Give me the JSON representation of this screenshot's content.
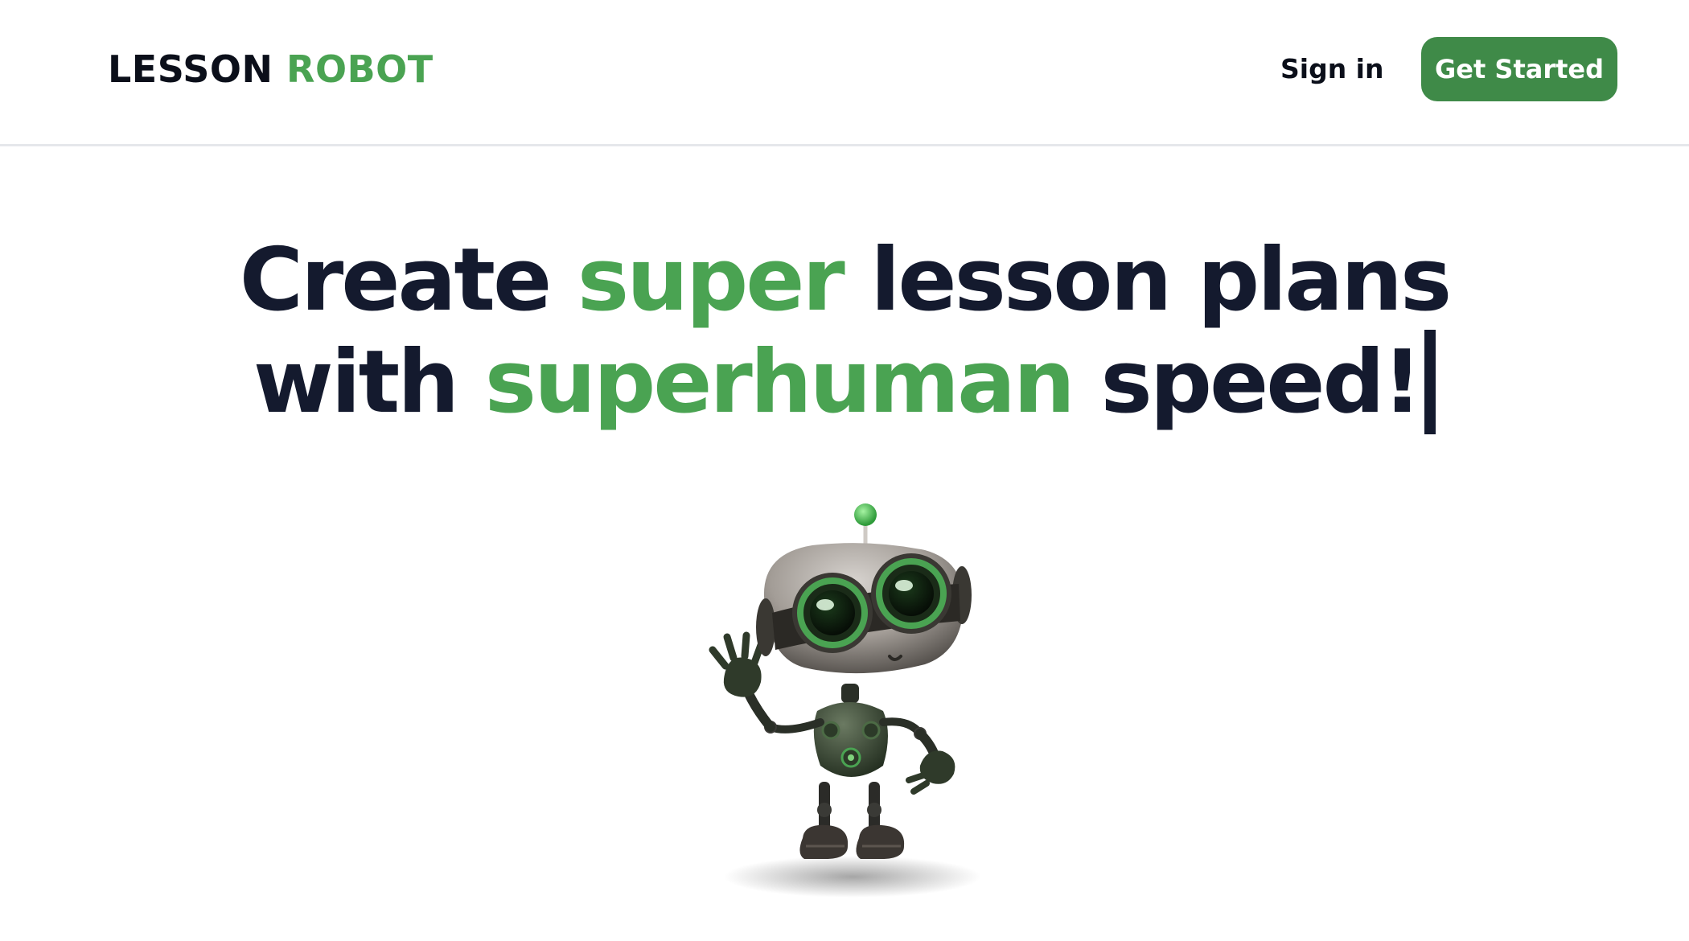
{
  "header": {
    "logo": {
      "word1": "LESSON",
      "word2": "ROBOT"
    },
    "signin_label": "Sign in",
    "cta_label": "Get Started"
  },
  "hero": {
    "line1": {
      "a": "Create ",
      "b": "super",
      "c": " lesson plans"
    },
    "line2": {
      "a": "with ",
      "b": "superhuman",
      "c": " speed!"
    }
  },
  "colors": {
    "accent_green": "#4aa352",
    "button_green": "#3f8a48",
    "heading_dark": "#141a2e"
  },
  "illustration": {
    "subject": "waving-green-robot"
  }
}
